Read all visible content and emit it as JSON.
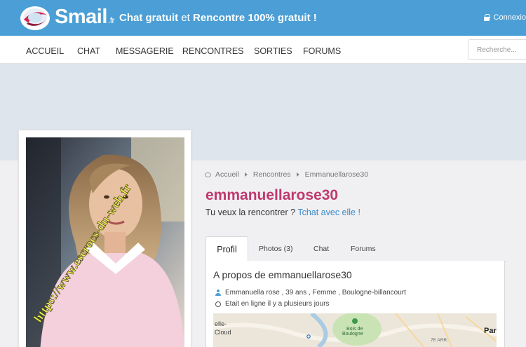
{
  "header": {
    "logo_text": "Smail",
    "logo_tld": ".fr",
    "tagline_part1": "Chat gratuit",
    "tagline_part2": " et ",
    "tagline_part3": "Rencontre 100% gratuit !",
    "login_label": "Connexio",
    "background_color": "#4b9fd6"
  },
  "nav": {
    "items": [
      "ACCUEIL",
      "CHAT",
      "MESSAGERIE",
      "RENCONTRES",
      "SORTIES",
      "FORUMS"
    ]
  },
  "search": {
    "placeholder": "Recherche..."
  },
  "photo": {
    "watermark": "https://www.escrocs-du-web.fr"
  },
  "breadcrumb": [
    "Accueil",
    "Rencontres",
    "Emmanuellarose30"
  ],
  "profile": {
    "username": "emmanuellarose30",
    "username_color": "#c0396c",
    "question": "Tu veux la rencontrer ?",
    "chat_link": "Tchat avec elle !"
  },
  "tabs": [
    "Profil",
    "Photos (3)",
    "Chat",
    "Forums"
  ],
  "about": {
    "title": "A propos de emmanuellarose30",
    "details": "Emmanuella rose , 39 ans , Femme , Boulogne-billancourt",
    "online_status": "Etait en ligne il y a plusieurs jours"
  },
  "map": {
    "labels": [
      "elle-",
      "Cloud",
      "Bois de",
      "Boulogne",
      "Par",
      "7E ARR."
    ]
  }
}
